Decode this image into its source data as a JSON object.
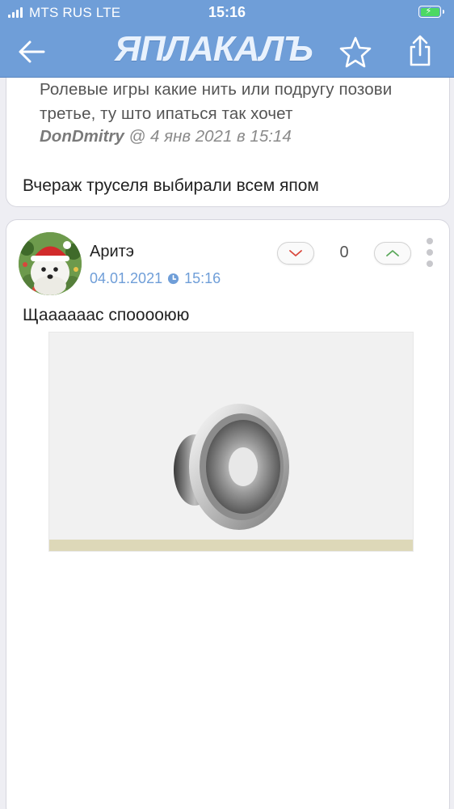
{
  "status_bar": {
    "carrier": "MTS RUS  LTE",
    "time": "15:16"
  },
  "nav": {
    "logo": "ЯПЛАКАЛЪ",
    "brand_color": "#6f9ed8"
  },
  "previous_comment": {
    "quote_text": "Ролевые игры какие нить или подругу позови третье, ту што ипаться так хочет",
    "quote_author": "DonDmitry",
    "quote_sep": "@",
    "quote_date": "4 янв 2021 в 15:14",
    "text": "Вчераж труселя выбирали всем япом"
  },
  "comment": {
    "username": "Аритэ",
    "date": "04.01.2021",
    "time": "15:16",
    "score": "0",
    "text": "Щааааaac споооoюю"
  },
  "icons": [
    "back-arrow-icon",
    "star-icon",
    "share-icon",
    "clock-icon",
    "chevron-down-icon",
    "chevron-up-icon",
    "more-vertical-icon",
    "speaker-icon"
  ]
}
